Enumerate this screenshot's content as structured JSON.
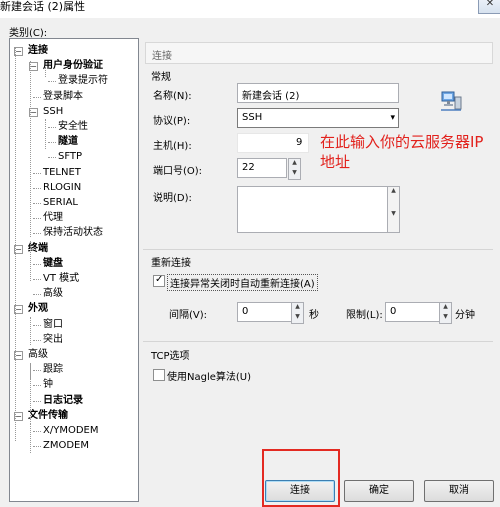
{
  "window": {
    "title": "新建会话 (2)属性",
    "close_glyph": "✕"
  },
  "category_label": "类别(C):",
  "tree": {
    "items": [
      {
        "label": "连接",
        "bold": true
      },
      {
        "label": "用户身份验证",
        "bold": true
      },
      {
        "label": "登录提示符",
        "bold": false
      },
      {
        "label": "登录脚本",
        "bold": false
      },
      {
        "label": "SSH",
        "bold": false
      },
      {
        "label": "安全性",
        "bold": false
      },
      {
        "label": "隧道",
        "bold": true
      },
      {
        "label": "SFTP",
        "bold": false
      },
      {
        "label": "TELNET",
        "bold": false
      },
      {
        "label": "RLOGIN",
        "bold": false
      },
      {
        "label": "SERIAL",
        "bold": false
      },
      {
        "label": "代理",
        "bold": false
      },
      {
        "label": "保持活动状态",
        "bold": false
      },
      {
        "label": "终端",
        "bold": true
      },
      {
        "label": "键盘",
        "bold": true
      },
      {
        "label": "VT 模式",
        "bold": false
      },
      {
        "label": "高级",
        "bold": false
      },
      {
        "label": "外观",
        "bold": true
      },
      {
        "label": "窗口",
        "bold": false
      },
      {
        "label": "突出",
        "bold": false
      },
      {
        "label": "高级",
        "bold": false
      },
      {
        "label": "跟踪",
        "bold": false
      },
      {
        "label": "钟",
        "bold": false
      },
      {
        "label": "日志记录",
        "bold": true
      },
      {
        "label": "文件传输",
        "bold": true
      },
      {
        "label": "X/YMODEM",
        "bold": false
      },
      {
        "label": "ZMODEM",
        "bold": false
      }
    ],
    "expander_glyph": "−"
  },
  "breadcrumb": "连接",
  "general": {
    "title": "常规",
    "name_label": "名称(N):",
    "name_value": "新建会话 (2)",
    "protocol_label": "协议(P):",
    "protocol_value": "SSH",
    "host_label": "主机(H):",
    "host_value": "9",
    "port_label": "端口号(O):",
    "port_value": "22",
    "desc_label": "说明(D):",
    "desc_value": ""
  },
  "annotation": {
    "line1": "在此输入你的云服务器IP",
    "line2": "地址"
  },
  "reconnect": {
    "title": "重新连接",
    "checkbox_label": "连接异常关闭时自动重新连接(A)",
    "checked": true,
    "interval_label": "间隔(V):",
    "interval_value": "0",
    "interval_unit": "秒",
    "limit_label": "限制(L):",
    "limit_value": "0",
    "limit_unit": "分钟"
  },
  "tcp": {
    "title": "TCP选项",
    "nagle_label": "使用Nagle算法(U)",
    "checked": false
  },
  "buttons": {
    "connect": "连接",
    "ok": "确定",
    "cancel": "取消"
  },
  "colors": {
    "annotation_red": "#e2211c",
    "highlight_box": "#e32a22"
  }
}
